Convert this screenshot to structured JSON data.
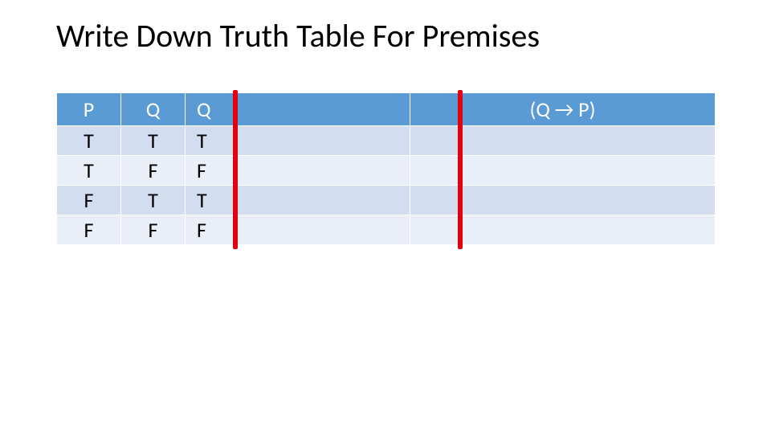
{
  "title": "Write Down Truth Table For Premises",
  "headers": {
    "c1": "P",
    "c2": "Q",
    "c3": "Q",
    "c4": "(Q → P)"
  },
  "rows": [
    {
      "p": "T",
      "q": "T",
      "q2": "T",
      "imp": ""
    },
    {
      "p": "T",
      "q": "F",
      "q2": "F",
      "imp": ""
    },
    {
      "p": "F",
      "q": "T",
      "q2": "T",
      "imp": ""
    },
    {
      "p": "F",
      "q": "F",
      "q2": "F",
      "imp": ""
    }
  ],
  "chart_data": {
    "type": "table",
    "title": "Write Down Truth Table For Premises",
    "columns": [
      "P",
      "Q",
      "Q",
      "(Q → P)"
    ],
    "rows": [
      [
        "T",
        "T",
        "T",
        ""
      ],
      [
        "T",
        "F",
        "F",
        ""
      ],
      [
        "F",
        "T",
        "T",
        ""
      ],
      [
        "F",
        "F",
        "F",
        ""
      ]
    ],
    "annotations": [
      "red vertical divider after column 2",
      "red vertical divider after column 3"
    ]
  }
}
